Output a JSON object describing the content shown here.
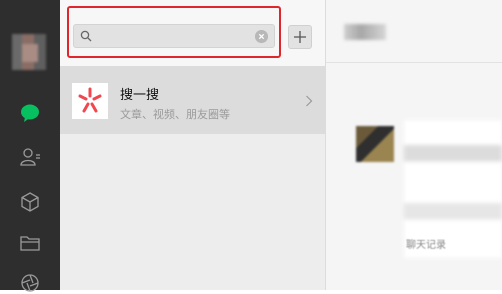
{
  "app": {
    "accent_color": "#07c160",
    "highlight_color": "#e0262d"
  },
  "rail": {
    "icons": [
      "avatar",
      "chat-icon",
      "contacts-icon",
      "cube-icon",
      "folder-icon",
      "moments-icon"
    ]
  },
  "search": {
    "value": "",
    "placeholder": ""
  },
  "toolbar": {
    "add_label": "+"
  },
  "result": {
    "title": "搜一搜",
    "subtitle": "文章、视频、朋友圈等"
  },
  "chat": {
    "bubble_label": "聊天记录"
  }
}
